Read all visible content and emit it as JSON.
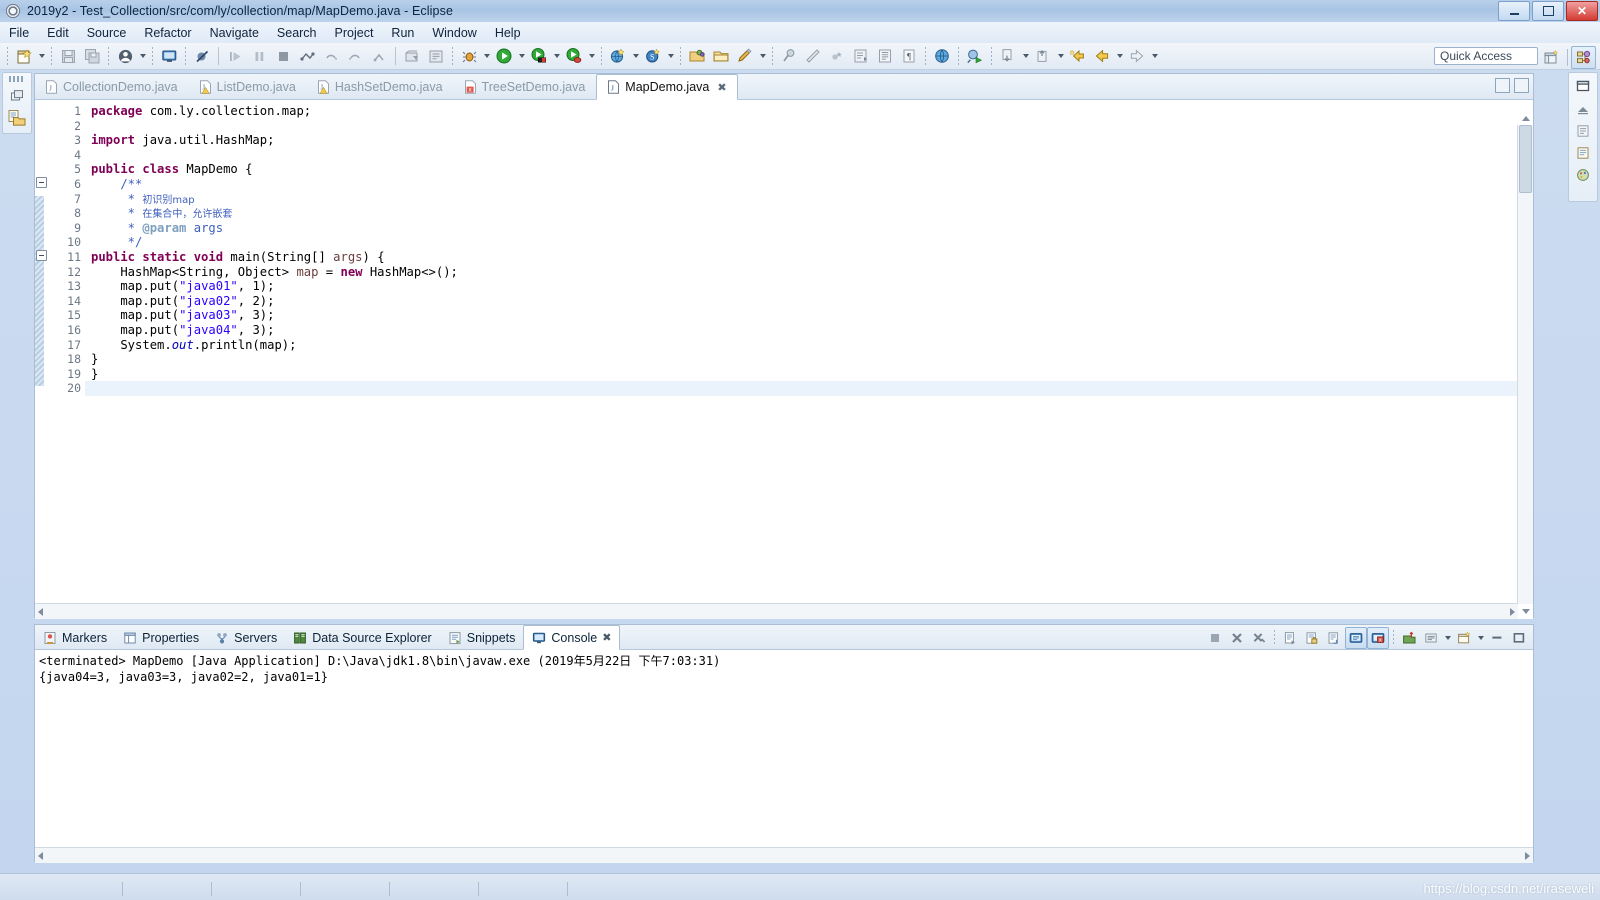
{
  "window": {
    "title": "2019y2 - Test_Collection/src/com/ly/collection/map/MapDemo.java - Eclipse",
    "app_icon": "eclipse-gear-icon",
    "minimize_label": "–",
    "maximize_label": "□",
    "close_label": "✕"
  },
  "menubar": {
    "items": [
      {
        "label": "File"
      },
      {
        "label": "Edit"
      },
      {
        "label": "Source"
      },
      {
        "label": "Refactor"
      },
      {
        "label": "Navigate"
      },
      {
        "label": "Search"
      },
      {
        "label": "Project"
      },
      {
        "label": "Run"
      },
      {
        "label": "Window"
      },
      {
        "label": "Help"
      }
    ]
  },
  "toolbar": {
    "quick_access_placeholder": "Quick Access",
    "buttons": [
      {
        "name": "new-wizard-icon",
        "tip": "New"
      },
      {
        "name": "save-icon",
        "tip": "Save"
      },
      {
        "name": "save-all-icon",
        "tip": "Save All"
      },
      {
        "name": "user-account-icon",
        "tip": "User"
      },
      {
        "name": "console-view-icon",
        "tip": "Open Console"
      },
      {
        "name": "skip-breakpoints-icon",
        "tip": "Skip All Breakpoints"
      },
      {
        "name": "resume-icon",
        "tip": "Resume"
      },
      {
        "name": "suspend-icon",
        "tip": "Suspend"
      },
      {
        "name": "terminate-icon",
        "tip": "Terminate"
      },
      {
        "name": "step-into-icon",
        "tip": "Step Into"
      },
      {
        "name": "step-over-icon",
        "tip": "Step Over"
      },
      {
        "name": "step-return-icon",
        "tip": "Step Return"
      },
      {
        "name": "new-java-project-icon",
        "tip": "New Java Project"
      },
      {
        "name": "new-java-package-icon",
        "tip": "New Java Package"
      },
      {
        "name": "debug-icon",
        "tip": "Debug"
      },
      {
        "name": "run-icon",
        "tip": "Run"
      },
      {
        "name": "run-coverage-icon",
        "tip": "Coverage"
      },
      {
        "name": "external-tools-icon",
        "tip": "External Tools"
      },
      {
        "name": "new-web-project-icon",
        "tip": "New Web Project"
      },
      {
        "name": "search-scope-icon",
        "tip": "Search"
      },
      {
        "name": "open-type-icon",
        "tip": "Open Type"
      },
      {
        "name": "open-task-icon",
        "tip": "Open Task"
      },
      {
        "name": "edit-marker-icon",
        "tip": "Edit"
      },
      {
        "name": "pin-icon",
        "tip": "Pin"
      },
      {
        "name": "ruler-icon",
        "tip": "Toggle Ruler"
      },
      {
        "name": "annotation-icon",
        "tip": "Annotation"
      },
      {
        "name": "block-selection-icon",
        "tip": "Block Selection"
      },
      {
        "name": "show-whitespace-icon",
        "tip": "Show Whitespace"
      },
      {
        "name": "paragraph-icon",
        "tip": "Paragraph Marks"
      },
      {
        "name": "open-browser-icon",
        "tip": "Open Web Browser"
      },
      {
        "name": "run-last-tool-icon",
        "tip": "Run Last Tool"
      },
      {
        "name": "previous-annotation-icon",
        "tip": "Previous Annotation"
      },
      {
        "name": "next-annotation-icon",
        "tip": "Next Annotation"
      },
      {
        "name": "last-edit-location-icon",
        "tip": "Last Edit Location"
      },
      {
        "name": "back-icon",
        "tip": "Back"
      },
      {
        "name": "forward-icon",
        "tip": "Forward"
      }
    ],
    "perspective": {
      "open_perspective": "open-perspective-icon",
      "java_perspective": "java-perspective-icon"
    }
  },
  "left_rail": {
    "items": [
      {
        "name": "restore-view-icon",
        "label": "Restore"
      },
      {
        "name": "package-explorer-icon",
        "label": "Package Explorer"
      }
    ]
  },
  "right_rail": {
    "items": [
      {
        "name": "restore-view-icon",
        "label": "Restore"
      },
      {
        "name": "outline-view-icon",
        "label": "Outline"
      },
      {
        "name": "task-list-icon",
        "label": "Task List"
      },
      {
        "name": "templates-view-icon",
        "label": "Templates"
      },
      {
        "name": "palette-view-icon",
        "label": "Palette"
      }
    ]
  },
  "editor": {
    "tabs": [
      {
        "label": "CollectionDemo.java",
        "icon": "java-file-icon",
        "active": false,
        "marker": "none"
      },
      {
        "label": "ListDemo.java",
        "icon": "java-file-warning-icon",
        "active": false,
        "marker": "warning"
      },
      {
        "label": "HashSetDemo.java",
        "icon": "java-file-warning-icon",
        "active": false,
        "marker": "warning"
      },
      {
        "label": "TreeSetDemo.java",
        "icon": "java-file-error-icon",
        "active": false,
        "marker": "error"
      },
      {
        "label": "MapDemo.java",
        "icon": "java-file-icon",
        "active": true,
        "marker": "none",
        "close": "✖"
      }
    ],
    "line_numbers": [
      "1",
      "2",
      "3",
      "4",
      "5",
      "6",
      "7",
      "8",
      "9",
      "10",
      "11",
      "12",
      "13",
      "14",
      "15",
      "16",
      "17",
      "18",
      "19",
      "20"
    ],
    "code_lines": [
      {
        "n": 1,
        "tokens": [
          {
            "t": "package ",
            "c": "kw"
          },
          {
            "t": "com.ly.collection.map;",
            "c": "plain"
          }
        ]
      },
      {
        "n": 2,
        "tokens": []
      },
      {
        "n": 3,
        "tokens": [
          {
            "t": "import ",
            "c": "kw"
          },
          {
            "t": "java.util.HashMap;",
            "c": "plain"
          }
        ]
      },
      {
        "n": 4,
        "tokens": []
      },
      {
        "n": 5,
        "tokens": [
          {
            "t": "public class ",
            "c": "kw"
          },
          {
            "t": "MapDemo {",
            "c": "plain"
          }
        ]
      },
      {
        "n": 6,
        "tokens": [
          {
            "t": "    /**",
            "c": "jdoc"
          }
        ],
        "fold": true
      },
      {
        "n": 7,
        "tokens": [
          {
            "t": "     * ",
            "c": "jdoc"
          },
          {
            "t": "初识别map",
            "c": "jdoc cn"
          }
        ]
      },
      {
        "n": 8,
        "tokens": [
          {
            "t": "     * ",
            "c": "jdoc"
          },
          {
            "t": "在集合中，允许嵌套",
            "c": "jdoc cn"
          }
        ]
      },
      {
        "n": 9,
        "tokens": [
          {
            "t": "     * ",
            "c": "jdoc"
          },
          {
            "t": "@param",
            "c": "jtag"
          },
          {
            "t": " args",
            "c": "jdoc"
          }
        ]
      },
      {
        "n": 10,
        "tokens": [
          {
            "t": "     */",
            "c": "jdoc"
          }
        ]
      },
      {
        "n": 11,
        "tokens": [
          {
            "t": "public static void ",
            "c": "kw"
          },
          {
            "t": "main(String[] ",
            "c": "plain"
          },
          {
            "t": "args",
            "c": "parm"
          },
          {
            "t": ") {",
            "c": "plain"
          }
        ],
        "fold": true
      },
      {
        "n": 12,
        "tokens": [
          {
            "t": "    HashMap<String, Object> ",
            "c": "plain"
          },
          {
            "t": "map",
            "c": "loc"
          },
          {
            "t": " = ",
            "c": "plain"
          },
          {
            "t": "new ",
            "c": "kw"
          },
          {
            "t": "HashMap<>();",
            "c": "plain"
          }
        ]
      },
      {
        "n": 13,
        "tokens": [
          {
            "t": "    map.put(",
            "c": "plain"
          },
          {
            "t": "\"java01\"",
            "c": "str"
          },
          {
            "t": ", 1);",
            "c": "plain"
          }
        ]
      },
      {
        "n": 14,
        "tokens": [
          {
            "t": "    map.put(",
            "c": "plain"
          },
          {
            "t": "\"java02\"",
            "c": "str"
          },
          {
            "t": ", 2);",
            "c": "plain"
          }
        ]
      },
      {
        "n": 15,
        "tokens": [
          {
            "t": "    map.put(",
            "c": "plain"
          },
          {
            "t": "\"java03\"",
            "c": "str"
          },
          {
            "t": ", 3);",
            "c": "plain"
          }
        ]
      },
      {
        "n": 16,
        "tokens": [
          {
            "t": "    map.put(",
            "c": "plain"
          },
          {
            "t": "\"java04\"",
            "c": "str"
          },
          {
            "t": ", 3);",
            "c": "plain"
          }
        ]
      },
      {
        "n": 17,
        "tokens": [
          {
            "t": "    System.",
            "c": "plain"
          },
          {
            "t": "out",
            "c": "fld"
          },
          {
            "t": ".println(map);",
            "c": "plain"
          }
        ]
      },
      {
        "n": 18,
        "tokens": [
          {
            "t": "}",
            "c": "plain"
          }
        ]
      },
      {
        "n": 19,
        "tokens": [
          {
            "t": "}",
            "c": "plain"
          }
        ]
      },
      {
        "n": 20,
        "tokens": [],
        "current": true
      }
    ]
  },
  "console_panel": {
    "tabs": [
      {
        "label": "Markers",
        "icon": "markers-icon",
        "active": false
      },
      {
        "label": "Properties",
        "icon": "properties-icon",
        "active": false
      },
      {
        "label": "Servers",
        "icon": "servers-icon",
        "active": false
      },
      {
        "label": "Data Source Explorer",
        "icon": "data-source-explorer-icon",
        "active": false
      },
      {
        "label": "Snippets",
        "icon": "snippets-icon",
        "active": false
      },
      {
        "label": "Console",
        "icon": "console-icon",
        "active": true,
        "close": "✖"
      }
    ],
    "tools": [
      {
        "name": "terminate-icon"
      },
      {
        "name": "remove-launch-icon"
      },
      {
        "name": "remove-all-terminated-icon"
      },
      {
        "name": "clear-console-icon"
      },
      {
        "name": "scroll-lock-icon"
      },
      {
        "name": "word-wrap-icon"
      },
      {
        "name": "show-console-on-output-icon",
        "toggled": true
      },
      {
        "name": "show-console-on-error-icon",
        "toggled": true
      },
      {
        "name": "pin-console-icon"
      },
      {
        "name": "display-selected-console-icon"
      },
      {
        "name": "display-selected-console-arrow-icon"
      },
      {
        "name": "open-console-icon"
      },
      {
        "name": "open-console-arrow-icon"
      },
      {
        "name": "minimize-panel-icon"
      },
      {
        "name": "maximize-panel-icon"
      }
    ],
    "header_line": "<terminated> MapDemo [Java Application] D:\\Java\\jdk1.8\\bin\\javaw.exe (2019年5月22日 下午7:03:31)",
    "output_lines": [
      "{java04=3, java03=3, java02=2, java01=1}"
    ]
  },
  "statusbar": {
    "watermark": "https://blog.csdn.net/iraseweli"
  },
  "colors": {
    "keyword": "#7f0055",
    "string": "#2a00ff",
    "javadoc": "#3f5fbf",
    "javadoc_tag": "#7f9fbf",
    "field": "#0000c0",
    "parameter": "#6a3e3e",
    "title_bar": "#a8c4e4",
    "panel_border": "#a9bed2",
    "current_line": "#eaf2fb"
  }
}
